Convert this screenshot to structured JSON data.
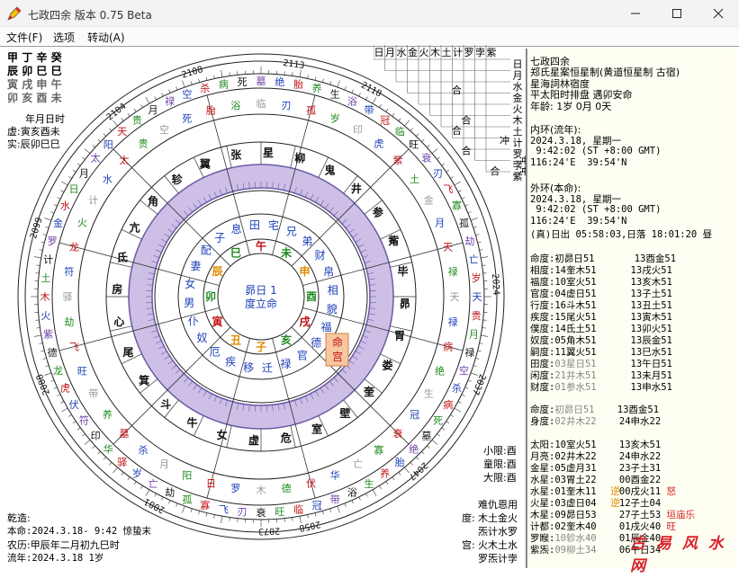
{
  "window": {
    "title": "七政四余 版本 0.75 Beta",
    "app_icon": "pencil-icon"
  },
  "menu": {
    "file": "文件(F)",
    "options": "选项",
    "convert": "转动(A)"
  },
  "pillars": {
    "row1": [
      "甲",
      "丁",
      "辛",
      "癸"
    ],
    "row2": [
      "辰",
      "卯",
      "巳",
      "巳"
    ],
    "row3": [
      "寅",
      "戌",
      "申",
      "午"
    ],
    "row4": [
      "卯",
      "亥",
      "酉",
      "未"
    ]
  },
  "ymd_header": "年月日时",
  "xu": "虚:寅亥酉未",
  "shi": "实:辰卯巳巳",
  "center": {
    "line1": "昴日 1",
    "line2": "度立命"
  },
  "year_marks": [
    "2108",
    "2113",
    "2104",
    "2118",
    "2099",
    "2024",
    "2088",
    "2037",
    "2081",
    "2047",
    "2073",
    "2058"
  ],
  "palaces_inner": [
    "命",
    "宫"
  ],
  "ring_stars": [
    "张",
    "星",
    "柳",
    "鬼",
    "井",
    "参",
    "觜",
    "毕",
    "昴",
    "胃",
    "娄",
    "奎",
    "壁",
    "室",
    "危",
    "虚",
    "女",
    "牛",
    "斗",
    "箕",
    "尾",
    "心",
    "房",
    "氐",
    "亢",
    "角",
    "轸",
    "翼"
  ],
  "grid_header": [
    "日",
    "月",
    "水",
    "金",
    "火",
    "木",
    "土",
    "计",
    "罗",
    "孛",
    "紫"
  ],
  "grid_labels": [
    "合",
    "合",
    "合",
    "合",
    "冲",
    "合",
    "冲",
    "冲",
    "冲"
  ],
  "side_grid": [
    "日",
    "月",
    "水",
    "金",
    "火",
    "木",
    "土",
    "计",
    "罗",
    "孛",
    "紫"
  ],
  "right_panel": {
    "title": "七政四余",
    "line1": "郑氏星案恒星制(黄道恒星制 古宿)",
    "line2": "星海詞林宿度",
    "line3": "平太阳时排盘 遇卯安命",
    "age": "年龄: 1岁 0月 0天",
    "inner_label": "内环(流年):",
    "inner_date": "2024.3.18, 星期一",
    "inner_time": " 9:42:02 (ST +8:00 GMT)",
    "inner_coords": "116:24'E  39:54'N",
    "outer_label": "外环(本命):",
    "outer_date": "2024.3.18, 星期一",
    "outer_time": " 9:42:02 (ST +8:00 GMT)",
    "outer_coords": "116:24'E  39:54'N",
    "sunrise": "(真)日出 05:58:03,日落 18:01:20 昼",
    "palaces": [
      {
        "name": "命度:",
        "a": "初昴日51",
        "b": "13酉金51"
      },
      {
        "name": "相度:",
        "a": "14奎木51",
        "b": "13戌火51"
      },
      {
        "name": "福度:",
        "a": "10室火51",
        "b": "13亥木51"
      },
      {
        "name": "官度:",
        "a": "04虚日51",
        "b": "13子土51"
      },
      {
        "name": "行度:",
        "a": "16斗木51",
        "b": "13丑土51"
      },
      {
        "name": "疾度:",
        "a": "15尾火51",
        "b": "13寅木51"
      },
      {
        "name": "僕度:",
        "a": "14氐土51",
        "b": "13卯火51"
      },
      {
        "name": "奴度:",
        "a": "05角木51",
        "b": "13辰金51"
      },
      {
        "name": "嗣度:",
        "a": "11翼火51",
        "b": "13巳水51"
      },
      {
        "name": "田度:",
        "a": "03星日51",
        "b": "13午日51"
      },
      {
        "name": "闲度:",
        "a": "21井木51",
        "b": "13未月51"
      },
      {
        "name": "财度:",
        "a": "01参水51",
        "b": "13申水51"
      }
    ],
    "ming": {
      "name": "命度:",
      "a": "初昴日51",
      "b": "13酉金51"
    },
    "shen": {
      "name": "身度:",
      "a": "02井木22",
      "b": "24申水22"
    },
    "planets": [
      {
        "name": "太阳:",
        "a": "10室火51",
        "b": "13亥木51",
        "note": ""
      },
      {
        "name": "月亮:",
        "a": "02井木22",
        "b": "24申水22",
        "note": ""
      },
      {
        "name": "金星:",
        "a": "05虚月31",
        "b": "23子土31",
        "note": ""
      },
      {
        "name": "水星:",
        "a": "03胃土22",
        "b": "00酉金22",
        "note": ""
      },
      {
        "name": "水星:",
        "a": "01奎木11",
        "b": "00戌火11",
        "note": "怒"
      },
      {
        "name": "火星:",
        "a": "03虚日04",
        "b": "12子土04",
        "note": ""
      },
      {
        "name": "木星:",
        "a": "09昴日53",
        "b": "27子土53",
        "note": "垣庙乐"
      },
      {
        "name": "计都:",
        "a": "02奎木40",
        "b": "01戌火40",
        "note": "旺"
      },
      {
        "name": "罗睺:",
        "a": "10轸水40",
        "b": "01辰金40",
        "note": ""
      },
      {
        "name": "紫炁:",
        "a": "09柳土34",
        "b": "06午日34",
        "note": ""
      }
    ],
    "planet_flags": [
      "逆",
      "逆"
    ]
  },
  "xianbox": {
    "small": "小限:酉",
    "child": "童限:酉",
    "big": "大限:酉",
    "label": "难仇恩用",
    "du_label": "度:",
    "du_vals": "木土金火",
    "du_vals2": "炁计水罗",
    "gong_label": "宫:",
    "gong_vals": "火木土水",
    "gong_vals2": "罗炁计孛"
  },
  "bottom": {
    "qianzao": "乾造:",
    "benming": "本命:2024.3.18- 9:42 惊蛰末",
    "nongli": "农历:甲辰年二月初九巳时",
    "liunian": "流年:2024.3.18 1岁"
  },
  "watermark": "古 易 风 水 网"
}
